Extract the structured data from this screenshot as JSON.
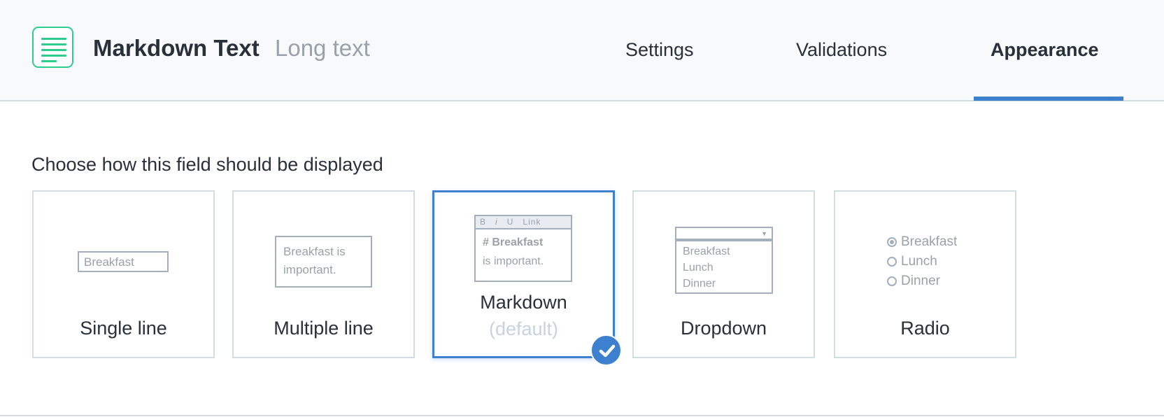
{
  "header": {
    "title": "Markdown Text",
    "subtitle": "Long text",
    "icon": "text-lines-icon",
    "icon_color": "#2ecc8f",
    "tabs": [
      {
        "label": "Settings",
        "active": false
      },
      {
        "label": "Validations",
        "active": false
      },
      {
        "label": "Appearance",
        "active": true
      }
    ],
    "accent_color": "#3c80cf"
  },
  "main": {
    "prompt": "Choose how this field should be displayed",
    "options": [
      {
        "label": "Single line",
        "selected": false,
        "preview": {
          "value": "Breakfast"
        }
      },
      {
        "label": "Multiple line",
        "selected": false,
        "preview": {
          "line1": "Breakfast is",
          "line2": "important."
        }
      },
      {
        "label": "Markdown",
        "sublabel": "(default)",
        "selected": true,
        "preview": {
          "toolbar": [
            "B",
            "i",
            "U",
            "Link"
          ],
          "line1": "# Breakfast",
          "line2": "is important."
        }
      },
      {
        "label": "Dropdown",
        "selected": false,
        "preview": {
          "options": [
            "Breakfast",
            "Lunch",
            "Dinner"
          ]
        }
      },
      {
        "label": "Radio",
        "selected": false,
        "preview": {
          "options": [
            "Breakfast",
            "Lunch",
            "Dinner"
          ],
          "checked": "Breakfast"
        }
      }
    ],
    "selected_icon": "checkmark-icon"
  }
}
